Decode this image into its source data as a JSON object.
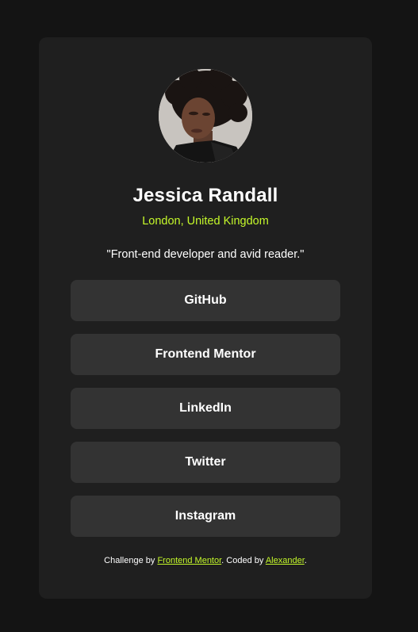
{
  "profile": {
    "name": "Jessica Randall",
    "location": "London, United Kingdom",
    "bio": "\"Front-end developer and avid reader.\""
  },
  "links": [
    {
      "label": "GitHub"
    },
    {
      "label": "Frontend Mentor"
    },
    {
      "label": "LinkedIn"
    },
    {
      "label": "Twitter"
    },
    {
      "label": "Instagram"
    }
  ],
  "footer": {
    "prefix": "Challenge by ",
    "challenge_link": "Frontend Mentor",
    "middle": ". Coded by ",
    "author_link": "Alexander",
    "suffix": "."
  },
  "colors": {
    "page_background": "#141414",
    "card_background": "#1f1f1f",
    "button_background": "#333333",
    "accent": "#c4f82a",
    "text": "#ffffff"
  }
}
